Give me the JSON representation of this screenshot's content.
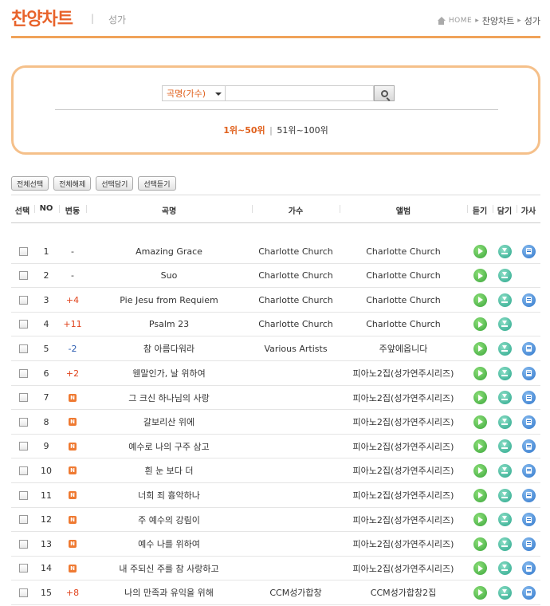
{
  "header": {
    "title": "찬양차트",
    "separator": "|",
    "subcategory": "성가",
    "breadcrumb": [
      "HOME",
      "찬양차트",
      "성가"
    ]
  },
  "search": {
    "select_value": "곡명(가수)",
    "input_value": "",
    "rank_range_active": "1위~50위",
    "rank_range_divider": "|",
    "rank_range_other": "51위~100위"
  },
  "actions": {
    "select_all": "전체선택",
    "deselect_all": "전체해제",
    "add_selected": "선택담기",
    "play_selected": "선택듣기"
  },
  "columns": {
    "select": "선택",
    "no": "NO",
    "change": "변동",
    "title": "곡명",
    "artist": "가수",
    "album": "앨범",
    "listen": "듣기",
    "add": "담기",
    "lyrics": "가사"
  },
  "new_badge": "N",
  "colors": {
    "accent": "#e8632b",
    "border_orange": "#f5c08a",
    "change_up": "#e0431c",
    "change_down": "#2a5bb0",
    "listen_icon": "#3aa53a",
    "add_icon": "#27a58a",
    "lyrics_icon": "#2a72c8"
  },
  "icons": {
    "listen": "play-icon",
    "add": "download-icon",
    "lyrics": "lyrics-icon",
    "search": "search-icon"
  },
  "rows": [
    {
      "no": "1",
      "change": "-",
      "change_type": "same",
      "title": "Amazing Grace",
      "artist": "Charlotte Church",
      "album": "Charlotte Church",
      "lyrics": true
    },
    {
      "no": "2",
      "change": "-",
      "change_type": "same",
      "title": "Suo",
      "artist": "Charlotte Church",
      "album": "Charlotte Church",
      "lyrics": false
    },
    {
      "no": "3",
      "change": "+4",
      "change_type": "up",
      "title": "Pie Jesu from Requiem",
      "artist": "Charlotte Church",
      "album": "Charlotte Church",
      "lyrics": true
    },
    {
      "no": "4",
      "change": "+11",
      "change_type": "up",
      "title": "Psalm 23",
      "artist": "Charlotte Church",
      "album": "Charlotte Church",
      "lyrics": false
    },
    {
      "no": "5",
      "change": "-2",
      "change_type": "down",
      "title": "참 아름다워라",
      "artist": "Various Artists",
      "album": "주앞에옵니다",
      "lyrics": true
    },
    {
      "no": "6",
      "change": "+2",
      "change_type": "up",
      "title": "웬말인가, 날 위하여",
      "artist": "",
      "album": "피아노2집(성가연주시리즈)",
      "lyrics": true
    },
    {
      "no": "7",
      "change": "N",
      "change_type": "new",
      "title": "그 크신 하나님의 사랑",
      "artist": "",
      "album": "피아노2집(성가연주시리즈)",
      "lyrics": true
    },
    {
      "no": "8",
      "change": "N",
      "change_type": "new",
      "title": "갈보리산 위에",
      "artist": "",
      "album": "피아노2집(성가연주시리즈)",
      "lyrics": true
    },
    {
      "no": "9",
      "change": "N",
      "change_type": "new",
      "title": "예수로 나의 구주 삼고",
      "artist": "",
      "album": "피아노2집(성가연주시리즈)",
      "lyrics": true
    },
    {
      "no": "10",
      "change": "N",
      "change_type": "new",
      "title": "흰 눈 보다 더",
      "artist": "",
      "album": "피아노2집(성가연주시리즈)",
      "lyrics": true
    },
    {
      "no": "11",
      "change": "N",
      "change_type": "new",
      "title": "너희 죄 흉악하나",
      "artist": "",
      "album": "피아노2집(성가연주시리즈)",
      "lyrics": true
    },
    {
      "no": "12",
      "change": "N",
      "change_type": "new",
      "title": "주 예수의 강림이",
      "artist": "",
      "album": "피아노2집(성가연주시리즈)",
      "lyrics": true
    },
    {
      "no": "13",
      "change": "N",
      "change_type": "new",
      "title": "예수 나를 위하여",
      "artist": "",
      "album": "피아노2집(성가연주시리즈)",
      "lyrics": true
    },
    {
      "no": "14",
      "change": "N",
      "change_type": "new",
      "title": "내 주되신 주를 참 사랑하고",
      "artist": "",
      "album": "피아노2집(성가연주시리즈)",
      "lyrics": true
    },
    {
      "no": "15",
      "change": "+8",
      "change_type": "up",
      "title": "나의 만족과 유익을 위해",
      "artist": "CCM성가합창",
      "album": "CCM성가합창2집",
      "lyrics": true
    }
  ]
}
